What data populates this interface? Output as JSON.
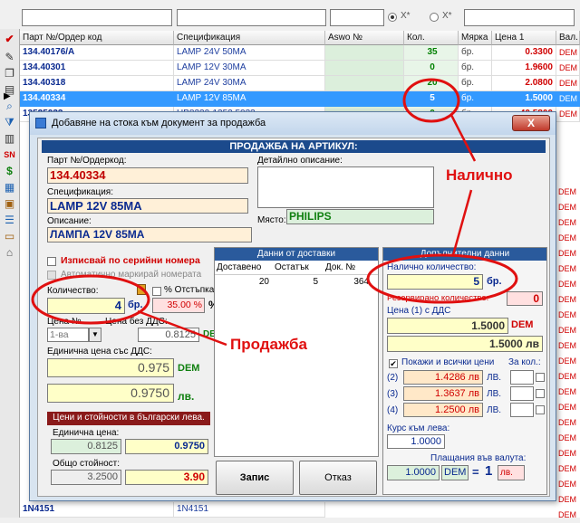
{
  "toolbar": {
    "radio1_label": "X*",
    "radio2_label": "X*"
  },
  "grid": {
    "headers": [
      "Парт №/Ордер код",
      "Спецификация",
      "Aswo №",
      "Кол.",
      "Мярка",
      "Цена 1",
      "Вал."
    ],
    "rows": [
      {
        "code": "134.40176/A",
        "spec": "LAMP 24V 50MA",
        "aswo": "",
        "qty": "35",
        "unit": "бр.",
        "price": "0.3300",
        "cur": "DEM"
      },
      {
        "code": "134.40301",
        "spec": "LAMP 12V 30MA",
        "aswo": "",
        "qty": "0",
        "unit": "бр.",
        "price": "1.9600",
        "cur": "DEM"
      },
      {
        "code": "134.40318",
        "spec": "LAMP 24V 30MA",
        "aswo": "",
        "qty": "20",
        "unit": "бр.",
        "price": "2.0800",
        "cur": "DEM"
      },
      {
        "code": "134.40334",
        "spec": "LAMP 12V 85MA",
        "aswo": "",
        "qty": "5",
        "unit": "бр.",
        "price": "1.5000",
        "cur": "DEM"
      },
      {
        "code": "13525033",
        "spec": "HB8320-1352.5033",
        "aswo": "",
        "qty": "0",
        "unit": "бр.",
        "price": "40.5800",
        "cur": "DEM"
      }
    ],
    "bottom_row": {
      "code": "1N4151",
      "spec": "1N4151"
    },
    "right_col_cur": "DEM"
  },
  "dialog": {
    "title": "Добавяне на стока към документ за продажба",
    "close_label": "X",
    "section_title": "ПРОДАЖБА НА АРТИКУЛ:",
    "part_label": "Парт №/Ордеркод:",
    "part_value": "134.40334",
    "spec_label": "Спецификация:",
    "spec_value": "LAMP 12V 85MA",
    "desc_label": "Описание:",
    "desc_value": "ЛАМПА 12V 85MA",
    "detail_label": "Детайлно описание:",
    "place_label": "Място:",
    "place_value": "PHILIPS",
    "serial_label": "Изписвай по серийни номера",
    "auto_label": "Автоматично маркирай номерата",
    "qty_label": "Количество:",
    "qty_value": "4",
    "qty_unit": "бр.",
    "discount_label": "% Отстъпка:",
    "discount_value": "35.00 %",
    "discount_sym": "%",
    "price_no_label": "Цена №",
    "price_no_value": "1-ва",
    "price_novat_label": "Цена без ДДС:",
    "price_novat_value": "0.8125",
    "price_novat_cur": "DEM",
    "unit_vat_label": "Единична цена със ДДС:",
    "unit_vat_dem": "0.975",
    "unit_vat_dem_cur": "DEM",
    "unit_vat_lv": "0.9750",
    "unit_vat_lv_cur": "лв.",
    "bgn_section": "Цени и стойности в български лева.",
    "bgn_unit_label": "Единична цена:",
    "bgn_unit_1": "0.8125",
    "bgn_unit_2": "0.9750",
    "bgn_total_label": "Общо стойност:",
    "bgn_total_1": "3.2500",
    "bgn_total_2": "3.90",
    "delivery_title": "Данни от доставки",
    "delivery_headers": [
      "Доставено",
      "Остатък",
      "Док. №"
    ],
    "delivery_row": [
      "20",
      "5",
      "364"
    ],
    "save_label": "Запис",
    "cancel_label": "Отказ",
    "extra_title": "Допълнителни данни",
    "avail_label": "Налично количество:",
    "avail_value": "5",
    "avail_unit": "бр.",
    "reserved_label": "Резервирано количество:",
    "reserved_value": "0",
    "price1_label": "Цена (1) с ДДС",
    "price1_dem": "1.5000",
    "price1_dem_cur": "DEM",
    "price1_lv": "1.5000 лв",
    "show_all_label": "Покажи и всички цени",
    "for_qty_label": "За кол.:",
    "prices": [
      {
        "idx": "(2)",
        "val": "1.4286 лв",
        "cur": "ЛВ."
      },
      {
        "idx": "(3)",
        "val": "1.3637 лв",
        "cur": "ЛВ."
      },
      {
        "idx": "(4)",
        "val": "1.2500 лв",
        "cur": "ЛВ."
      }
    ],
    "rate_label": "Курс към лева:",
    "rate_value": "1.0000",
    "currency_label": "Плащания във валута:",
    "currency_value": "1.0000",
    "currency_code": "DEM",
    "currency_eq": "=",
    "currency_one": "1",
    "currency_lv": "лв."
  },
  "annotations": {
    "available": "Налично",
    "sale": "Продажба"
  },
  "colors": {
    "annotation": "#e01010",
    "section_bar": "#1b4a8c",
    "selection": "#3399ff"
  }
}
